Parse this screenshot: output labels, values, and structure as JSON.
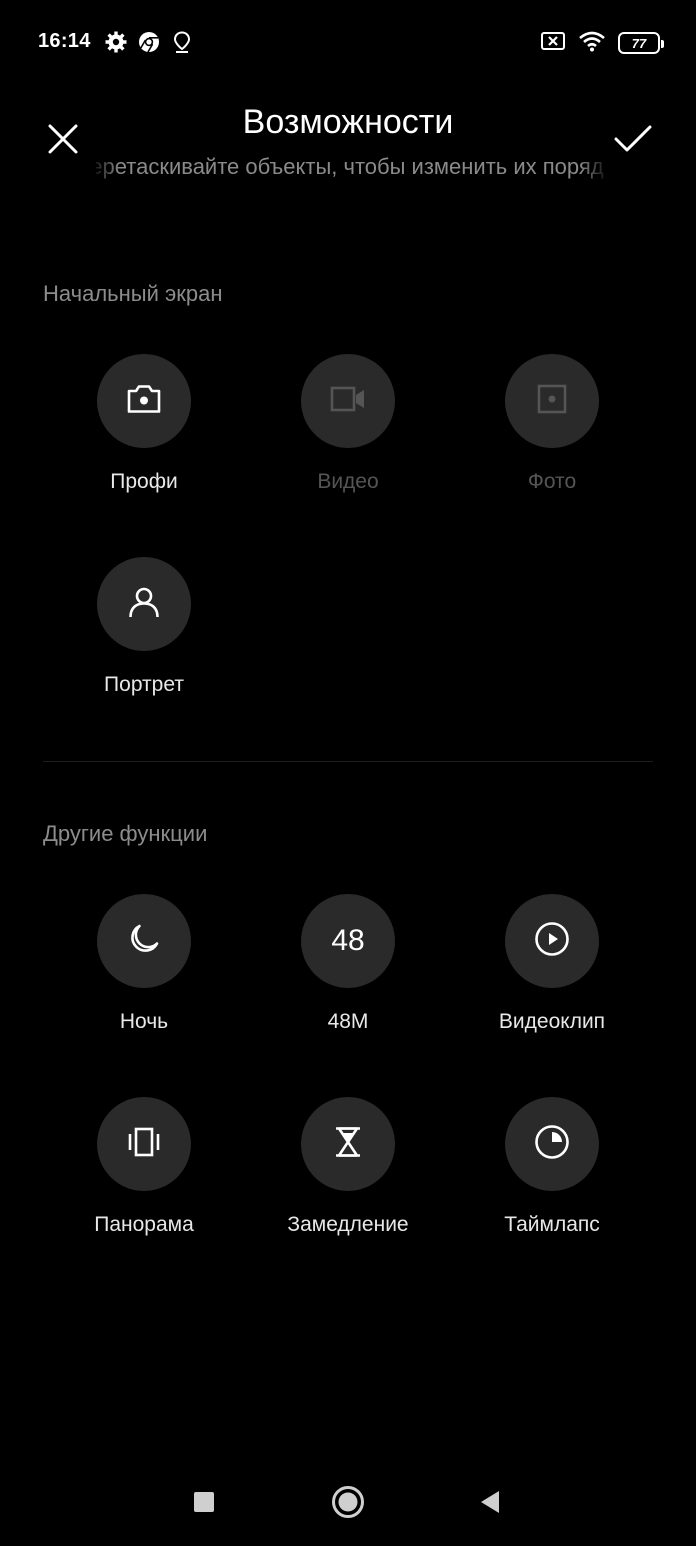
{
  "status_bar": {
    "time": "16:14",
    "battery": "77",
    "icons": [
      "gear-icon",
      "chrome-icon",
      "location-pin-icon",
      "sim-off-icon",
      "wifi-icon",
      "battery-icon"
    ]
  },
  "header": {
    "title": "Возможности",
    "subtitle": "Перетаскивайте объекты, чтобы изменить их порядок"
  },
  "home_section": {
    "title": "Начальный экран",
    "items": [
      {
        "label": "Профи",
        "icon": "camera-icon",
        "enabled": true
      },
      {
        "label": "Видео",
        "icon": "video-camera-icon",
        "enabled": false
      },
      {
        "label": "Фото",
        "icon": "photo-icon",
        "enabled": false
      },
      {
        "label": "Портрет",
        "icon": "person-icon",
        "enabled": true
      }
    ]
  },
  "other_section": {
    "title": "Другие функции",
    "items": [
      {
        "label": "Ночь",
        "icon": "moon-icon"
      },
      {
        "label": "48M",
        "icon": "48-icon",
        "badge": "48"
      },
      {
        "label": "Видеоклип",
        "icon": "play-icon"
      },
      {
        "label": "Панорама",
        "icon": "panorama-icon"
      },
      {
        "label": "Замедление",
        "icon": "hourglass-icon"
      },
      {
        "label": "Таймлапс",
        "icon": "timelapse-icon"
      }
    ]
  },
  "colors": {
    "background": "#000000",
    "tile": "#2a2a2a",
    "muted_text": "#8c8c8c",
    "disabled_text": "#555555"
  }
}
